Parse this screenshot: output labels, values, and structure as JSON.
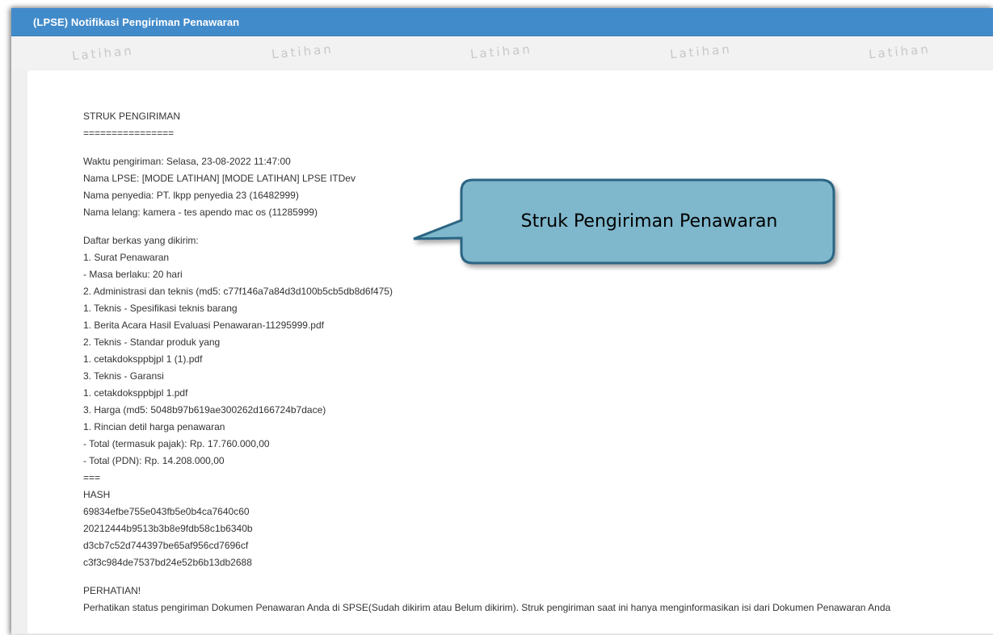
{
  "window": {
    "title": "(LPSE) Notifikasi Pengiriman Penawaran",
    "title_bar_color": "#428bca",
    "watermark_text": "Latihan"
  },
  "callout": {
    "label": "Struk Pengiriman Penawaran",
    "fill_color": "#7fb7cc",
    "border_color": "#2c6583"
  },
  "receipt": {
    "heading": "STRUK PENGIRIMAN",
    "heading_rule": "================",
    "info": [
      "Waktu pengiriman: Selasa, 23-08-2022 11:47:00",
      "Nama LPSE: [MODE LATIHAN] [MODE LATIHAN] LPSE ITDev",
      "Nama penyedia: PT. lkpp penyedia 23 (16482999)",
      "Nama lelang: kamera - tes apendo mac os (11285999)"
    ],
    "files": [
      "Daftar berkas yang dikirim:",
      "1. Surat Penawaran",
      "- Masa berlaku: 20 hari",
      "2. Administrasi dan teknis (md5: c77f146a7a84d3d100b5cb5db8d6f475)",
      "1. Teknis - Spesifikasi teknis barang",
      "1. Berita Acara Hasil Evaluasi Penawaran-11295999.pdf",
      "2. Teknis - Standar produk yang",
      "1. cetakdoksppbjpl 1 (1).pdf",
      "3. Teknis - Garansi",
      "1. cetakdoksppbjpl 1.pdf",
      "3. Harga (md5: 5048b97b619ae300262d166724b7dace)",
      "1. Rincian detil harga penawaran",
      "- Total (termasuk pajak): Rp. 17.760.000,00",
      "- Total (PDN): Rp. 14.208.000,00",
      "==="
    ],
    "hash_label": "HASH",
    "hashes": [
      "69834efbe755e043fb5e0b4ca7640c60",
      "20212444b9513b3b8e9fdb58c1b6340b",
      "d3cb7c52d744397be65af956cd7696cf",
      "c3f3c984de7537bd24e52b6b13db2688"
    ],
    "notice_title": "PERHATIAN!",
    "notice_text": "Perhatikan status pengiriman Dokumen Penawaran Anda di SPSE(Sudah dikirim atau Belum dikirim). Struk pengiriman saat ini hanya menginformasikan isi dari Dokumen Penawaran Anda"
  }
}
